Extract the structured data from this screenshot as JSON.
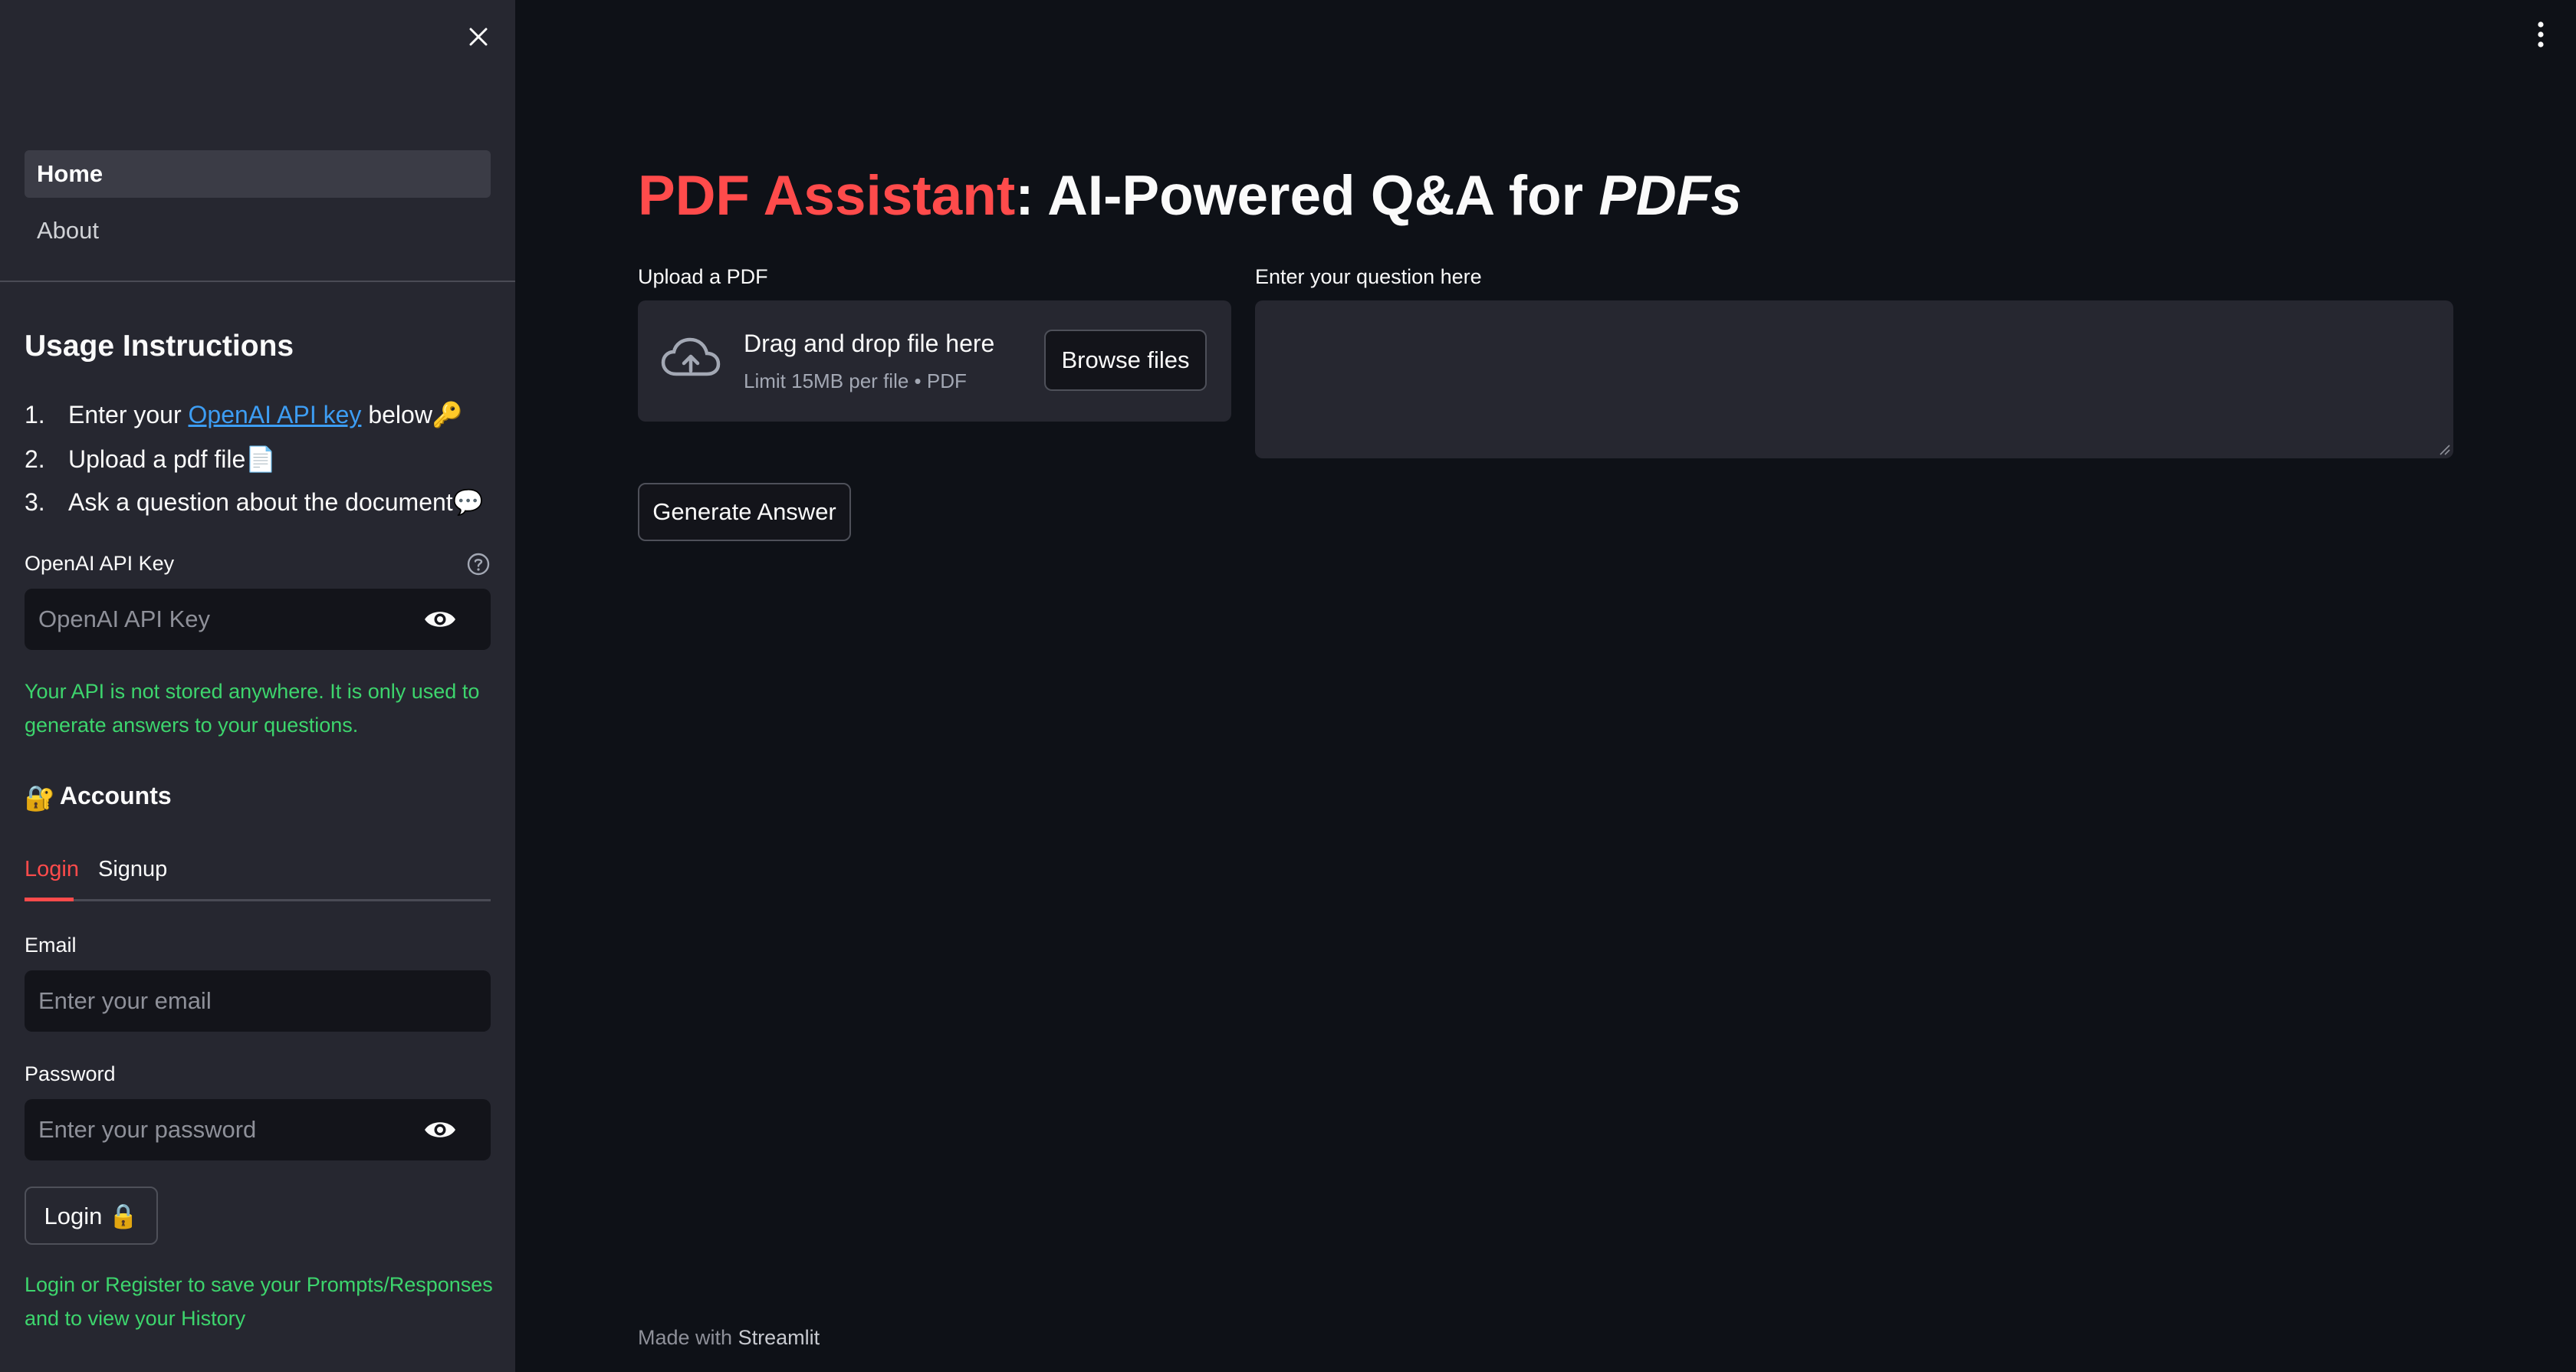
{
  "sidebar": {
    "nav": [
      {
        "label": "Home",
        "active": true
      },
      {
        "label": "About",
        "active": false
      }
    ],
    "usage_heading": "Usage Instructions",
    "instructions": [
      {
        "num": "1.",
        "prefix": "Enter your ",
        "link": "OpenAI API key",
        "suffix": " below",
        "emoji": "🔑"
      },
      {
        "num": "2.",
        "prefix": "Upload a pdf file",
        "emoji": "📄"
      },
      {
        "num": "3.",
        "prefix": "Ask a question about the document",
        "emoji": "💬"
      }
    ],
    "api_key": {
      "label": "OpenAI API Key",
      "placeholder": "OpenAI API Key",
      "value": ""
    },
    "api_note": "Your API is not stored anywhere. It is only used to generate answers to your questions.",
    "accounts_heading": "Accounts",
    "accounts_emoji": "🔐",
    "tabs": [
      {
        "label": "Login",
        "active": true
      },
      {
        "label": "Signup",
        "active": false
      }
    ],
    "email": {
      "label": "Email",
      "placeholder": "Enter your email",
      "value": ""
    },
    "password": {
      "label": "Password",
      "placeholder": "Enter your password",
      "value": ""
    },
    "login_button": "Login 🔒",
    "login_note": "Login or Register to save your Prompts/Responses and to view your History"
  },
  "main": {
    "title_accent": "PDF Assistant",
    "title_rest": ": AI-Powered Q&A for ",
    "title_italic": "PDFs",
    "upload_label": "Upload a PDF",
    "drop_title": "Drag and drop file here",
    "drop_limit": "Limit 15MB per file • PDF",
    "browse_button": "Browse files",
    "question_label": "Enter your question here",
    "question_value": "",
    "generate_button": "Generate Answer",
    "footer_prefix": "Made with ",
    "footer_brand": "Streamlit"
  },
  "colors": {
    "accent": "#ff4b4b",
    "success_text": "#3dd56d",
    "link": "#3d9df3",
    "background": "#0e1117",
    "sidebar_bg": "#262730"
  }
}
